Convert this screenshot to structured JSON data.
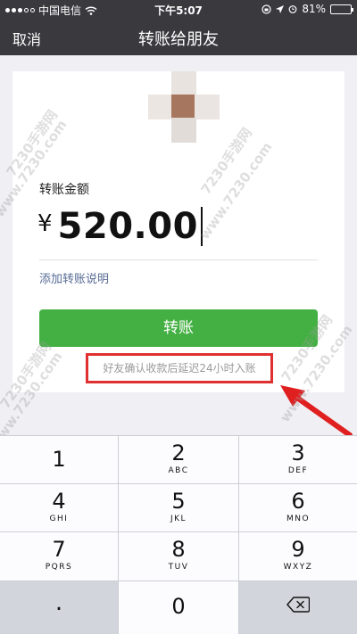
{
  "status_bar": {
    "carrier": "中国电信",
    "time": "下午5:07",
    "battery": "81%",
    "battery_level": 0.81
  },
  "nav": {
    "cancel_label": "取消",
    "title": "转账给朋友"
  },
  "transfer": {
    "amount_label": "转账金额",
    "currency_symbol": "¥",
    "amount_value": "520.00",
    "add_note_label": "添加转账说明",
    "button_label": "转账",
    "delay_note": "好友确认收款后延迟24小时入账"
  },
  "keypad": {
    "keys": [
      {
        "num": "1",
        "letters": ""
      },
      {
        "num": "2",
        "letters": "ABC"
      },
      {
        "num": "3",
        "letters": "DEF"
      },
      {
        "num": "4",
        "letters": "GHI"
      },
      {
        "num": "5",
        "letters": "JKL"
      },
      {
        "num": "6",
        "letters": "MNO"
      },
      {
        "num": "7",
        "letters": "PQRS"
      },
      {
        "num": "8",
        "letters": "TUV"
      },
      {
        "num": "9",
        "letters": "WXYZ"
      },
      {
        "num": ".",
        "letters": ""
      },
      {
        "num": "0",
        "letters": ""
      },
      {
        "num": "",
        "letters": "",
        "icon": "backspace-icon"
      }
    ]
  },
  "watermark": {
    "text_a": "7230手游网",
    "text_b": "www.7230.com"
  },
  "colors": {
    "nav_bg": "#3a393e",
    "button_green": "#44b043",
    "highlight_red": "#e03030",
    "link_blue": "#576b95"
  }
}
